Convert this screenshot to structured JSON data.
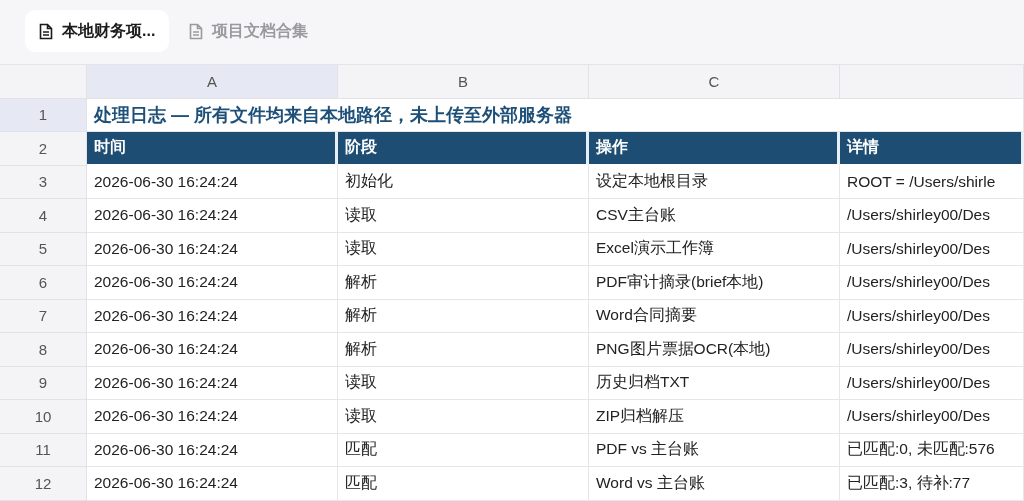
{
  "tabs": [
    {
      "label": "本地财务项...",
      "selected": true
    },
    {
      "label": "项目文档合集",
      "selected": false
    }
  ],
  "sheet": {
    "column_headers": [
      {
        "label": "A",
        "selected": true
      },
      {
        "label": "B",
        "selected": false
      },
      {
        "label": "C",
        "selected": false
      }
    ],
    "rows": [
      {
        "number": "1",
        "selected": true,
        "kind": "title",
        "cells": [
          "处理日志 — 所有文件均来自本地路径，未上传至外部服务器"
        ]
      },
      {
        "number": "2",
        "selected": false,
        "kind": "header",
        "cells": [
          "时间",
          "阶段",
          "操作",
          "详情"
        ]
      },
      {
        "number": "3",
        "selected": false,
        "kind": "data",
        "cells": [
          "2026-06-30 16:24:24",
          "初始化",
          "设定本地根目录",
          "ROOT = /Users/shirle"
        ]
      },
      {
        "number": "4",
        "selected": false,
        "kind": "data",
        "cells": [
          "2026-06-30 16:24:24",
          "读取",
          "CSV主台账",
          "/Users/shirley00/Des"
        ]
      },
      {
        "number": "5",
        "selected": false,
        "kind": "data",
        "cells": [
          "2026-06-30 16:24:24",
          "读取",
          "Excel演示工作簿",
          "/Users/shirley00/Des"
        ]
      },
      {
        "number": "6",
        "selected": false,
        "kind": "data",
        "cells": [
          "2026-06-30 16:24:24",
          "解析",
          "PDF审计摘录(brief本地)",
          "/Users/shirley00/Des"
        ]
      },
      {
        "number": "7",
        "selected": false,
        "kind": "data",
        "cells": [
          "2026-06-30 16:24:24",
          "解析",
          "Word合同摘要",
          "/Users/shirley00/Des"
        ]
      },
      {
        "number": "8",
        "selected": false,
        "kind": "data",
        "cells": [
          "2026-06-30 16:24:24",
          "解析",
          "PNG图片票据OCR(本地)",
          "/Users/shirley00/Des"
        ]
      },
      {
        "number": "9",
        "selected": false,
        "kind": "data",
        "cells": [
          "2026-06-30 16:24:24",
          "读取",
          "历史归档TXT",
          "/Users/shirley00/Des"
        ]
      },
      {
        "number": "10",
        "selected": false,
        "kind": "data",
        "cells": [
          "2026-06-30 16:24:24",
          "读取",
          "ZIP归档解压",
          "/Users/shirley00/Des"
        ]
      },
      {
        "number": "11",
        "selected": false,
        "kind": "data",
        "cells": [
          "2026-06-30 16:24:24",
          "匹配",
          "PDF vs 主台账",
          "已匹配:0, 未匹配:576"
        ]
      },
      {
        "number": "12",
        "selected": false,
        "kind": "data",
        "cells": [
          "2026-06-30 16:24:24",
          "匹配",
          "Word vs 主台账",
          "已匹配:3, 待补:77"
        ]
      }
    ]
  }
}
